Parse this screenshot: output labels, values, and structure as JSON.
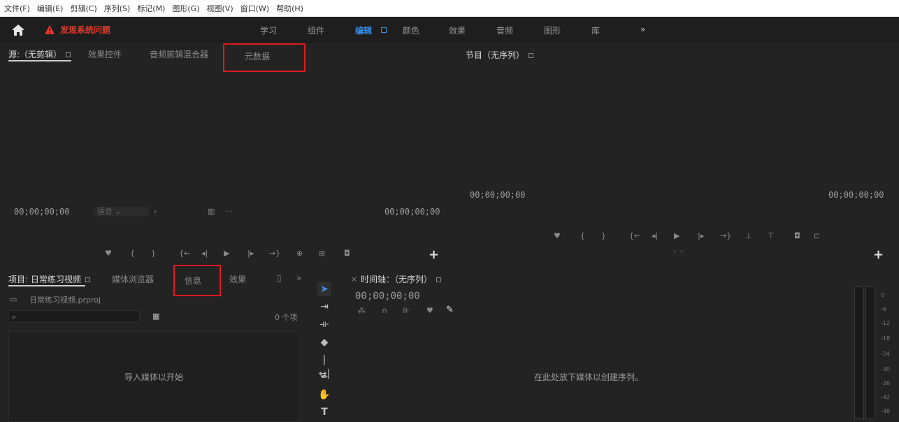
{
  "menu": [
    "文件(F)",
    "编辑(E)",
    "剪辑(C)",
    "序列(S)",
    "标记(M)",
    "图形(G)",
    "视图(V)",
    "窗口(W)",
    "帮助(H)"
  ],
  "workspace": {
    "warning": "发现系统问题",
    "tabs": [
      "学习",
      "组件",
      "编辑",
      "颜色",
      "效果",
      "音频",
      "图形",
      "库"
    ],
    "active_tab": "编辑",
    "more": "»"
  },
  "source_panel": {
    "tabs": [
      "源:（无剪辑）",
      "效果控件",
      "音频剪辑混合器",
      "元数据"
    ],
    "timecode_left": "00;00;00;00",
    "timecode_right": "00;00;00;00",
    "fit_dropdown": "适合"
  },
  "program_panel": {
    "tab": "节目（无序列）",
    "timecode_left": "00;00;00;00",
    "timecode_right": "00;00;00;00"
  },
  "project_panel": {
    "tabs": [
      "项目: 日常练习视频",
      "媒体浏览器",
      "信息",
      "效果"
    ],
    "more": "»",
    "project_file": "日常练习视频.prproj",
    "item_count": "0 个项",
    "drop_text": "导入媒体以开始"
  },
  "timeline_panel": {
    "tab": "时间轴：（无序列）",
    "timecode": "00;00;00;00",
    "drop_text": "在此处放下媒体以创建序列。"
  },
  "audio_meter": {
    "labels": [
      "0",
      "-6",
      "-12",
      "-18",
      "-24",
      "-30",
      "-36",
      "-42",
      "-48"
    ]
  },
  "icons": [
    "home-icon",
    "warning-icon",
    "selection-tool-icon",
    "track-select-icon",
    "ripple-edit-icon",
    "razor-icon",
    "slip-icon",
    "pen-icon",
    "hand-icon",
    "type-icon"
  ],
  "colors": {
    "accent": "#3a8ee6",
    "warning": "#e33a2c",
    "highlight_box": "#e0191f"
  }
}
